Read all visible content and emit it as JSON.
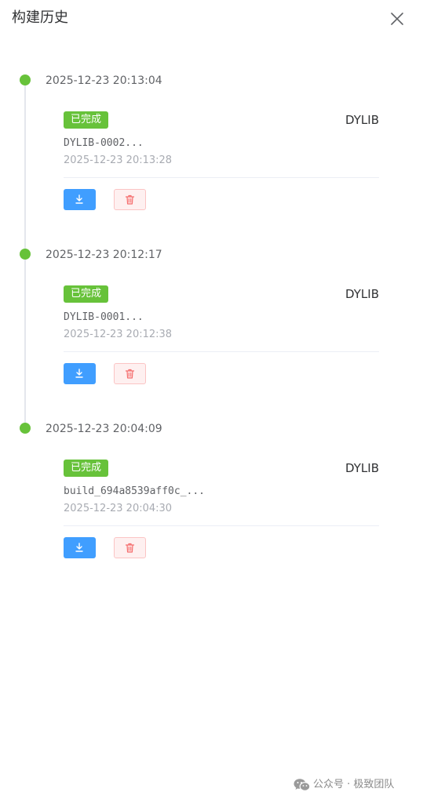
{
  "header": {
    "title": "构建历史",
    "close_icon": "close-icon"
  },
  "builds": [
    {
      "time": "2025-12-23 20:13:04",
      "status": "已完成",
      "type": "DYLIB",
      "file_name": "DYLIB-0002...",
      "created": "2025-12-23 20:13:28"
    },
    {
      "time": "2025-12-23 20:12:17",
      "status": "已完成",
      "type": "DYLIB",
      "file_name": "DYLIB-0001...",
      "created": "2025-12-23 20:12:38"
    },
    {
      "time": "2025-12-23 20:04:09",
      "status": "已完成",
      "type": "DYLIB",
      "file_name": "build_694a8539aff0c_...",
      "created": "2025-12-23 20:04:30"
    }
  ],
  "actions": {
    "download_icon": "download-icon",
    "delete_icon": "trash-icon"
  },
  "watermark": {
    "text": "公众号 · 极致团队",
    "icon": "wechat-icon"
  },
  "colors": {
    "success": "#67c23a",
    "primary": "#409eff",
    "danger": "#f56c6c",
    "danger_bg": "#fef0f0"
  }
}
